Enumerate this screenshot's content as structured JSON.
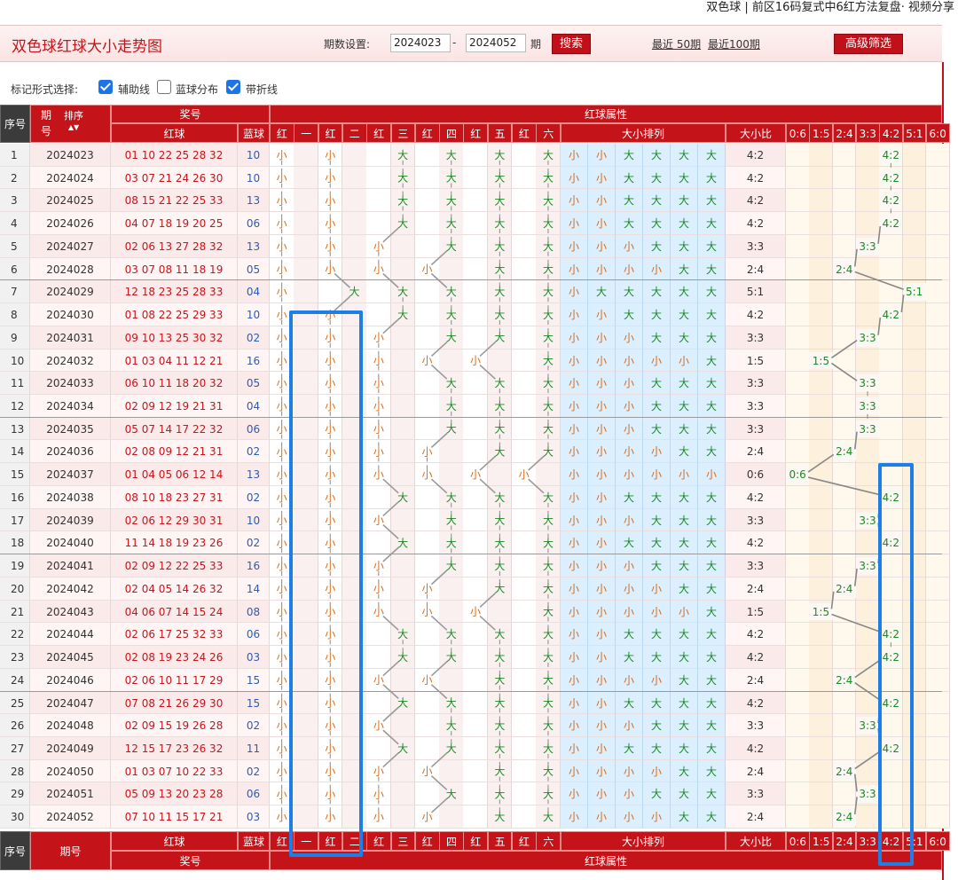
{
  "top_caption": "双色球 | 前区16码复式中6红方法复盘· 视频分享",
  "header": {
    "title": "双色球红球大小走势图",
    "period_label": "期数设置:",
    "from": "2024023",
    "sep": "-",
    "to": "2024052",
    "unit": "期",
    "search_btn": "搜索",
    "recent50": "最近 50期",
    "recent100": "最近100期",
    "filter_btn": "高级筛选"
  },
  "options": {
    "label": "标记形式选择:",
    "opt1": "辅助线",
    "opt1_checked": true,
    "opt2": "蓝球分布",
    "opt2_checked": false,
    "opt3": "带折线",
    "opt3_checked": true
  },
  "table_header": {
    "seq": "序号",
    "period": "期号",
    "period_char1": "期",
    "period_char2": "号",
    "sort": "排序",
    "prize": "奖号",
    "red_ball": "红球",
    "blue_ball": "蓝球",
    "red_attr": "红球属性",
    "positions": [
      "红",
      "一",
      "红",
      "二",
      "红",
      "三",
      "红",
      "四",
      "红",
      "五",
      "红",
      "六"
    ],
    "size_order": "大小排列",
    "ratio": "大小比",
    "ratios": [
      "0:6",
      "1:5",
      "2:4",
      "3:3",
      "4:2",
      "5:1",
      "6:0"
    ]
  },
  "rows": [
    {
      "seq": "1",
      "period": "2024023",
      "reds": "01 10 22 25 28 32",
      "blue": "10",
      "marks": [
        "小",
        "小",
        "大",
        "大",
        "大",
        "大"
      ],
      "ratio": "4:2"
    },
    {
      "seq": "2",
      "period": "2024024",
      "reds": "03 07 21 24 26 30",
      "blue": "10",
      "marks": [
        "小",
        "小",
        "大",
        "大",
        "大",
        "大"
      ],
      "ratio": "4:2"
    },
    {
      "seq": "3",
      "period": "2024025",
      "reds": "08 15 21 22 25 33",
      "blue": "13",
      "marks": [
        "小",
        "小",
        "大",
        "大",
        "大",
        "大"
      ],
      "ratio": "4:2"
    },
    {
      "seq": "4",
      "period": "2024026",
      "reds": "04 07 18 19 20 25",
      "blue": "06",
      "marks": [
        "小",
        "小",
        "大",
        "大",
        "大",
        "大"
      ],
      "ratio": "4:2"
    },
    {
      "seq": "5",
      "period": "2024027",
      "reds": "02 06 13 27 28 32",
      "blue": "13",
      "marks": [
        "小",
        "小",
        "小",
        "大",
        "大",
        "大"
      ],
      "ratio": "3:3"
    },
    {
      "seq": "6",
      "period": "2024028",
      "reds": "03 07 08 11 18 19",
      "blue": "05",
      "marks": [
        "小",
        "小",
        "小",
        "小",
        "大",
        "大"
      ],
      "ratio": "2:4"
    },
    {
      "seq": "7",
      "period": "2024029",
      "reds": "12 18 23 25 28 33",
      "blue": "04",
      "marks": [
        "小",
        "大",
        "大",
        "大",
        "大",
        "大"
      ],
      "ratio": "5:1"
    },
    {
      "seq": "8",
      "period": "2024030",
      "reds": "01 08 22 25 29 33",
      "blue": "10",
      "marks": [
        "小",
        "小",
        "大",
        "大",
        "大",
        "大"
      ],
      "ratio": "4:2"
    },
    {
      "seq": "9",
      "period": "2024031",
      "reds": "09 10 13 25 30 32",
      "blue": "02",
      "marks": [
        "小",
        "小",
        "小",
        "大",
        "大",
        "大"
      ],
      "ratio": "3:3"
    },
    {
      "seq": "10",
      "period": "2024032",
      "reds": "01 03 04 11 12 21",
      "blue": "16",
      "marks": [
        "小",
        "小",
        "小",
        "小",
        "小",
        "大"
      ],
      "ratio": "1:5"
    },
    {
      "seq": "11",
      "period": "2024033",
      "reds": "06 10 11 18 20 32",
      "blue": "05",
      "marks": [
        "小",
        "小",
        "小",
        "大",
        "大",
        "大"
      ],
      "ratio": "3:3"
    },
    {
      "seq": "12",
      "period": "2024034",
      "reds": "02 09 12 19 21 31",
      "blue": "04",
      "marks": [
        "小",
        "小",
        "小",
        "大",
        "大",
        "大"
      ],
      "ratio": "3:3"
    },
    {
      "seq": "13",
      "period": "2024035",
      "reds": "05 07 14 17 22 32",
      "blue": "06",
      "marks": [
        "小",
        "小",
        "小",
        "大",
        "大",
        "大"
      ],
      "ratio": "3:3"
    },
    {
      "seq": "14",
      "period": "2024036",
      "reds": "02 08 09 12 21 31",
      "blue": "02",
      "marks": [
        "小",
        "小",
        "小",
        "小",
        "大",
        "大"
      ],
      "ratio": "2:4"
    },
    {
      "seq": "15",
      "period": "2024037",
      "reds": "01 04 05 06 12 14",
      "blue": "13",
      "marks": [
        "小",
        "小",
        "小",
        "小",
        "小",
        "小"
      ],
      "ratio": "0:6"
    },
    {
      "seq": "16",
      "period": "2024038",
      "reds": "08 10 18 23 27 31",
      "blue": "02",
      "marks": [
        "小",
        "小",
        "大",
        "大",
        "大",
        "大"
      ],
      "ratio": "4:2"
    },
    {
      "seq": "17",
      "period": "2024039",
      "reds": "02 06 12 29 30 31",
      "blue": "10",
      "marks": [
        "小",
        "小",
        "小",
        "大",
        "大",
        "大"
      ],
      "ratio": "3:3"
    },
    {
      "seq": "18",
      "period": "2024040",
      "reds": "11 14 18 19 23 26",
      "blue": "02",
      "marks": [
        "小",
        "小",
        "大",
        "大",
        "大",
        "大"
      ],
      "ratio": "4:2"
    },
    {
      "seq": "19",
      "period": "2024041",
      "reds": "02 09 12 22 25 33",
      "blue": "16",
      "marks": [
        "小",
        "小",
        "小",
        "大",
        "大",
        "大"
      ],
      "ratio": "3:3"
    },
    {
      "seq": "20",
      "period": "2024042",
      "reds": "02 04 05 14 26 32",
      "blue": "14",
      "marks": [
        "小",
        "小",
        "小",
        "小",
        "大",
        "大"
      ],
      "ratio": "2:4"
    },
    {
      "seq": "21",
      "period": "2024043",
      "reds": "04 06 07 14 15 24",
      "blue": "08",
      "marks": [
        "小",
        "小",
        "小",
        "小",
        "小",
        "大"
      ],
      "ratio": "1:5"
    },
    {
      "seq": "22",
      "period": "2024044",
      "reds": "02 06 17 25 32 33",
      "blue": "06",
      "marks": [
        "小",
        "小",
        "大",
        "大",
        "大",
        "大"
      ],
      "ratio": "4:2"
    },
    {
      "seq": "23",
      "period": "2024045",
      "reds": "02 08 19 23 24 26",
      "blue": "03",
      "marks": [
        "小",
        "小",
        "大",
        "大",
        "大",
        "大"
      ],
      "ratio": "4:2"
    },
    {
      "seq": "24",
      "period": "2024046",
      "reds": "02 06 10 11 17 29",
      "blue": "15",
      "marks": [
        "小",
        "小",
        "小",
        "小",
        "大",
        "大"
      ],
      "ratio": "2:4"
    },
    {
      "seq": "25",
      "period": "2024047",
      "reds": "07 08 21 26 29 30",
      "blue": "15",
      "marks": [
        "小",
        "小",
        "大",
        "大",
        "大",
        "大"
      ],
      "ratio": "4:2"
    },
    {
      "seq": "26",
      "period": "2024048",
      "reds": "02 09 15 19 26 28",
      "blue": "02",
      "marks": [
        "小",
        "小",
        "小",
        "大",
        "大",
        "大"
      ],
      "ratio": "3:3"
    },
    {
      "seq": "27",
      "period": "2024049",
      "reds": "12 15 17 23 26 32",
      "blue": "11",
      "marks": [
        "小",
        "小",
        "大",
        "大",
        "大",
        "大"
      ],
      "ratio": "4:2"
    },
    {
      "seq": "28",
      "period": "2024050",
      "reds": "01 03 07 10 22 33",
      "blue": "02",
      "marks": [
        "小",
        "小",
        "小",
        "小",
        "大",
        "大"
      ],
      "ratio": "2:4"
    },
    {
      "seq": "29",
      "period": "2024051",
      "reds": "05 09 13 20 23 28",
      "blue": "06",
      "marks": [
        "小",
        "小",
        "小",
        "大",
        "大",
        "大"
      ],
      "ratio": "3:3"
    },
    {
      "seq": "30",
      "period": "2024052",
      "reds": "07 10 11 15 17 21",
      "blue": "03",
      "marks": [
        "小",
        "小",
        "小",
        "小",
        "大",
        "大"
      ],
      "ratio": "2:4"
    }
  ],
  "colors": {
    "header_red": "#c5131a",
    "small": "#d66d1c",
    "large": "#1c8a25",
    "blue_num": "#2a5cb8",
    "red_num": "#c9141c",
    "highlight": "#1d7ee5"
  }
}
